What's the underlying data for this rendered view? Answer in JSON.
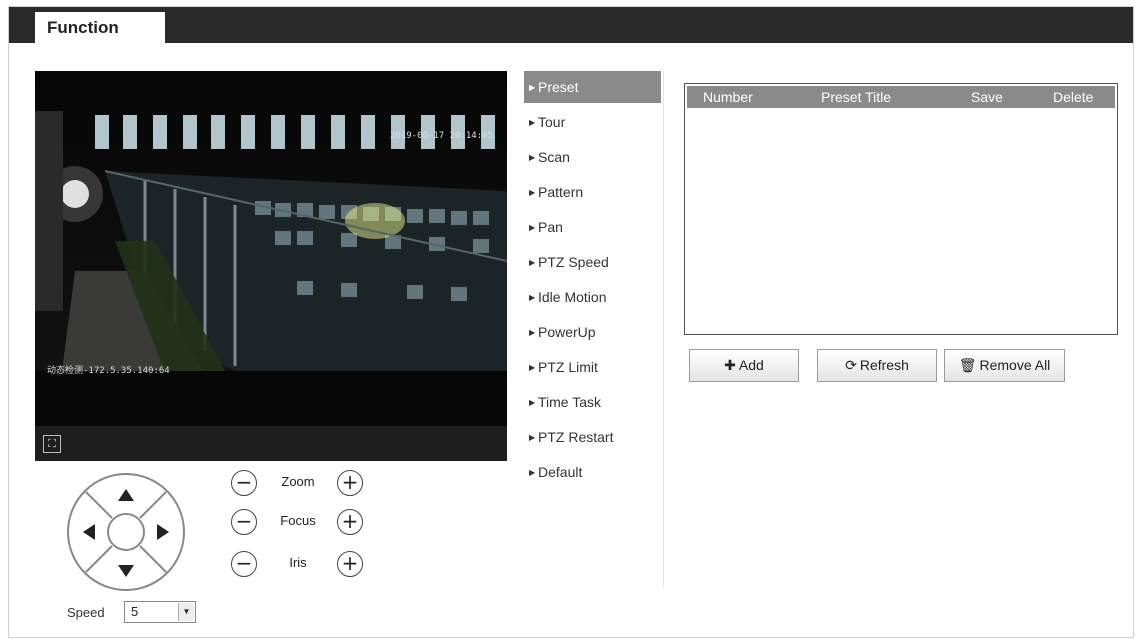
{
  "tab": {
    "label": "Function"
  },
  "video": {
    "osd_timestamp": "2019-06-17 20:14:05",
    "osd_camera": "动态检测-172.5.35.140:64",
    "fullscreen_icon": "fullscreen-icon"
  },
  "ptz": {
    "directions": [
      "up",
      "down",
      "left",
      "right"
    ],
    "zoom_label": "Zoom",
    "focus_label": "Focus",
    "iris_label": "Iris",
    "speed_label": "Speed",
    "speed_value": "5"
  },
  "menu": {
    "items": [
      {
        "label": "Preset",
        "active": true
      },
      {
        "label": "Tour"
      },
      {
        "label": "Scan"
      },
      {
        "label": "Pattern"
      },
      {
        "label": "Pan"
      },
      {
        "label": "PTZ Speed"
      },
      {
        "label": "Idle Motion"
      },
      {
        "label": "PowerUp"
      },
      {
        "label": "PTZ Limit"
      },
      {
        "label": "Time Task"
      },
      {
        "label": "PTZ Restart"
      },
      {
        "label": "Default"
      }
    ]
  },
  "preset_table": {
    "columns": [
      "Number",
      "Preset Title",
      "Save",
      "Delete"
    ],
    "rows": []
  },
  "buttons": {
    "add": "Add",
    "refresh": "Refresh",
    "remove_all": "Remove All"
  },
  "colors": {
    "menu_active_bg": "#8a8a8a",
    "topbar": "#2a2a2a"
  }
}
